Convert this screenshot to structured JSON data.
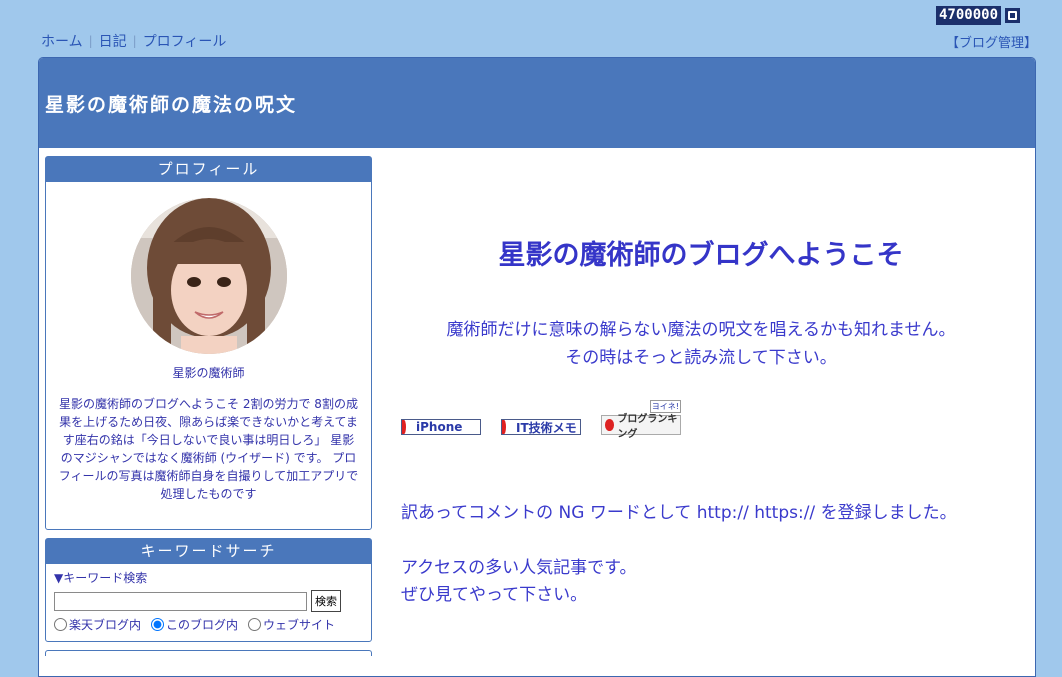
{
  "counter": {
    "value": "4700000"
  },
  "topnav": {
    "items": [
      "ホーム",
      "日記",
      "プロフィール"
    ]
  },
  "blog_admin": "【ブログ管理】",
  "banner": {
    "title": "星影の魔術師の魔法の呪文"
  },
  "profile": {
    "heading": "プロフィール",
    "name": "星影の魔術師",
    "text": "星影の魔術師のブログへようこそ 2割の労力で 8割の成果を上げるため日夜、隙あらば楽できないかと考えてます座右の銘は「今日しないで良い事は明日しろ」 星影のマジシャンではなく魔術師 (ウイザード) です。 プロフィールの写真は魔術師自身を自撮りして加工アプリで処理したものです"
  },
  "search": {
    "heading": "キーワードサーチ",
    "label": "▼キーワード検索",
    "input_value": "",
    "button": "検索",
    "options": [
      "楽天ブログ内",
      "このブログ内",
      "ウェブサイト"
    ],
    "selected": "このブログ内"
  },
  "main": {
    "welcome": "星影の魔術師のブログへようこそ",
    "intro_line1": "魔術師だけに意味の解らない魔法の呪文を唱えるかも知れません。",
    "intro_line2": "その時はそっと読み流して下さい。",
    "banner_iphone": "iPhone",
    "banner_it": "IT技術メモ",
    "rank_badge": "ヨイネ!",
    "rank_logo": "ブログランキング",
    "notice": "訳あってコメントの NG ワードとして http:// https:// を登録しました。",
    "popular_line1": "アクセスの多い人気記事です。",
    "popular_line2": "ぜひ見てやって下さい。"
  },
  "colors": {
    "page_bg": "#a0c8ec",
    "header_blue": "#4a77bb",
    "text_blue": "#3a3acc"
  }
}
